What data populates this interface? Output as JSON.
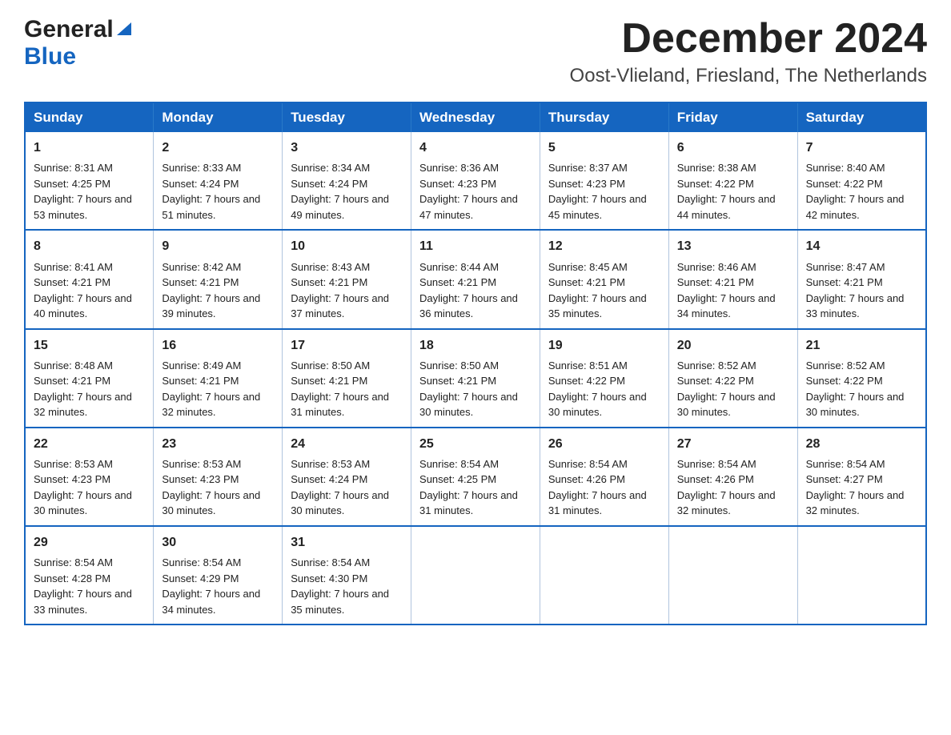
{
  "header": {
    "logo_general": "General",
    "logo_blue": "Blue",
    "month_title": "December 2024",
    "location": "Oost-Vlieland, Friesland, The Netherlands"
  },
  "days_of_week": [
    "Sunday",
    "Monday",
    "Tuesday",
    "Wednesday",
    "Thursday",
    "Friday",
    "Saturday"
  ],
  "weeks": [
    [
      {
        "date": "1",
        "sunrise": "Sunrise: 8:31 AM",
        "sunset": "Sunset: 4:25 PM",
        "daylight": "Daylight: 7 hours and 53 minutes."
      },
      {
        "date": "2",
        "sunrise": "Sunrise: 8:33 AM",
        "sunset": "Sunset: 4:24 PM",
        "daylight": "Daylight: 7 hours and 51 minutes."
      },
      {
        "date": "3",
        "sunrise": "Sunrise: 8:34 AM",
        "sunset": "Sunset: 4:24 PM",
        "daylight": "Daylight: 7 hours and 49 minutes."
      },
      {
        "date": "4",
        "sunrise": "Sunrise: 8:36 AM",
        "sunset": "Sunset: 4:23 PM",
        "daylight": "Daylight: 7 hours and 47 minutes."
      },
      {
        "date": "5",
        "sunrise": "Sunrise: 8:37 AM",
        "sunset": "Sunset: 4:23 PM",
        "daylight": "Daylight: 7 hours and 45 minutes."
      },
      {
        "date": "6",
        "sunrise": "Sunrise: 8:38 AM",
        "sunset": "Sunset: 4:22 PM",
        "daylight": "Daylight: 7 hours and 44 minutes."
      },
      {
        "date": "7",
        "sunrise": "Sunrise: 8:40 AM",
        "sunset": "Sunset: 4:22 PM",
        "daylight": "Daylight: 7 hours and 42 minutes."
      }
    ],
    [
      {
        "date": "8",
        "sunrise": "Sunrise: 8:41 AM",
        "sunset": "Sunset: 4:21 PM",
        "daylight": "Daylight: 7 hours and 40 minutes."
      },
      {
        "date": "9",
        "sunrise": "Sunrise: 8:42 AM",
        "sunset": "Sunset: 4:21 PM",
        "daylight": "Daylight: 7 hours and 39 minutes."
      },
      {
        "date": "10",
        "sunrise": "Sunrise: 8:43 AM",
        "sunset": "Sunset: 4:21 PM",
        "daylight": "Daylight: 7 hours and 37 minutes."
      },
      {
        "date": "11",
        "sunrise": "Sunrise: 8:44 AM",
        "sunset": "Sunset: 4:21 PM",
        "daylight": "Daylight: 7 hours and 36 minutes."
      },
      {
        "date": "12",
        "sunrise": "Sunrise: 8:45 AM",
        "sunset": "Sunset: 4:21 PM",
        "daylight": "Daylight: 7 hours and 35 minutes."
      },
      {
        "date": "13",
        "sunrise": "Sunrise: 8:46 AM",
        "sunset": "Sunset: 4:21 PM",
        "daylight": "Daylight: 7 hours and 34 minutes."
      },
      {
        "date": "14",
        "sunrise": "Sunrise: 8:47 AM",
        "sunset": "Sunset: 4:21 PM",
        "daylight": "Daylight: 7 hours and 33 minutes."
      }
    ],
    [
      {
        "date": "15",
        "sunrise": "Sunrise: 8:48 AM",
        "sunset": "Sunset: 4:21 PM",
        "daylight": "Daylight: 7 hours and 32 minutes."
      },
      {
        "date": "16",
        "sunrise": "Sunrise: 8:49 AM",
        "sunset": "Sunset: 4:21 PM",
        "daylight": "Daylight: 7 hours and 32 minutes."
      },
      {
        "date": "17",
        "sunrise": "Sunrise: 8:50 AM",
        "sunset": "Sunset: 4:21 PM",
        "daylight": "Daylight: 7 hours and 31 minutes."
      },
      {
        "date": "18",
        "sunrise": "Sunrise: 8:50 AM",
        "sunset": "Sunset: 4:21 PM",
        "daylight": "Daylight: 7 hours and 30 minutes."
      },
      {
        "date": "19",
        "sunrise": "Sunrise: 8:51 AM",
        "sunset": "Sunset: 4:22 PM",
        "daylight": "Daylight: 7 hours and 30 minutes."
      },
      {
        "date": "20",
        "sunrise": "Sunrise: 8:52 AM",
        "sunset": "Sunset: 4:22 PM",
        "daylight": "Daylight: 7 hours and 30 minutes."
      },
      {
        "date": "21",
        "sunrise": "Sunrise: 8:52 AM",
        "sunset": "Sunset: 4:22 PM",
        "daylight": "Daylight: 7 hours and 30 minutes."
      }
    ],
    [
      {
        "date": "22",
        "sunrise": "Sunrise: 8:53 AM",
        "sunset": "Sunset: 4:23 PM",
        "daylight": "Daylight: 7 hours and 30 minutes."
      },
      {
        "date": "23",
        "sunrise": "Sunrise: 8:53 AM",
        "sunset": "Sunset: 4:23 PM",
        "daylight": "Daylight: 7 hours and 30 minutes."
      },
      {
        "date": "24",
        "sunrise": "Sunrise: 8:53 AM",
        "sunset": "Sunset: 4:24 PM",
        "daylight": "Daylight: 7 hours and 30 minutes."
      },
      {
        "date": "25",
        "sunrise": "Sunrise: 8:54 AM",
        "sunset": "Sunset: 4:25 PM",
        "daylight": "Daylight: 7 hours and 31 minutes."
      },
      {
        "date": "26",
        "sunrise": "Sunrise: 8:54 AM",
        "sunset": "Sunset: 4:26 PM",
        "daylight": "Daylight: 7 hours and 31 minutes."
      },
      {
        "date": "27",
        "sunrise": "Sunrise: 8:54 AM",
        "sunset": "Sunset: 4:26 PM",
        "daylight": "Daylight: 7 hours and 32 minutes."
      },
      {
        "date": "28",
        "sunrise": "Sunrise: 8:54 AM",
        "sunset": "Sunset: 4:27 PM",
        "daylight": "Daylight: 7 hours and 32 minutes."
      }
    ],
    [
      {
        "date": "29",
        "sunrise": "Sunrise: 8:54 AM",
        "sunset": "Sunset: 4:28 PM",
        "daylight": "Daylight: 7 hours and 33 minutes."
      },
      {
        "date": "30",
        "sunrise": "Sunrise: 8:54 AM",
        "sunset": "Sunset: 4:29 PM",
        "daylight": "Daylight: 7 hours and 34 minutes."
      },
      {
        "date": "31",
        "sunrise": "Sunrise: 8:54 AM",
        "sunset": "Sunset: 4:30 PM",
        "daylight": "Daylight: 7 hours and 35 minutes."
      },
      null,
      null,
      null,
      null
    ]
  ]
}
